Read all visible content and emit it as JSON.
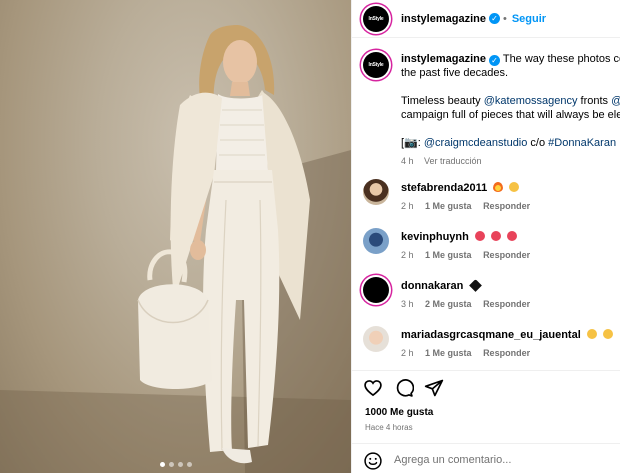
{
  "post": {
    "image_alt": "Model in an all-white outfit holding a white handbag against a beige wall",
    "carousel_dots": 4,
    "carousel_active": 0
  },
  "header": {
    "avatar_text": "InStyle",
    "username": "instylemagazine",
    "follow_label": "Seguir"
  },
  "caption": {
    "avatar_text": "InStyle",
    "username": "instylemagazine",
    "line1": "The way these photos could",
    "line2": "the past five decades.",
    "p2_prefix": "Timeless beauty ",
    "p2_mention1": "@katemossagency",
    "p2_mid": " fronts ",
    "p2_mention2": "@don",
    "p2_line2": "campaign full of pieces that will always be elega",
    "p3_prefix": "[📷: ",
    "p3_mention": "@craigmcdeanstudio",
    "p3_mid": " c/o ",
    "p3_hashtag": "#DonnaKaran",
    "time": "4 h",
    "translate_label": "Ver traducción"
  },
  "comments": [
    {
      "username": "stefabrenda2011",
      "time": "2 h",
      "likes": "1 Me gusta",
      "reply": "Responder"
    },
    {
      "username": "kevinphuynh",
      "time": "2 h",
      "likes": "1 Me gusta",
      "reply": "Responder"
    },
    {
      "username": "donnakaran",
      "time": "3 h",
      "likes": "2 Me gusta",
      "reply": "Responder"
    },
    {
      "username": "mariadasgrcasqmane_eu_jauental",
      "time": "2 h",
      "likes": "1 Me gusta",
      "reply": "Responder"
    }
  ],
  "stats": {
    "likes": "1000 Me gusta",
    "posted_ago": "Hace 4 horas"
  },
  "composer": {
    "placeholder": "Agrega un comentario..."
  },
  "colors": {
    "link": "#0095f6",
    "mention": "#00376b",
    "muted": "#737373",
    "story_ring": "#d6249f"
  }
}
